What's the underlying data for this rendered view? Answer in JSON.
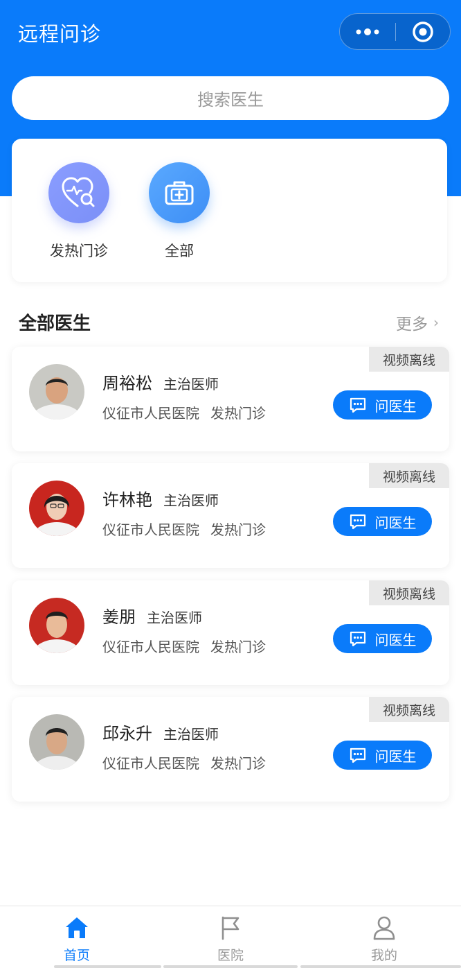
{
  "header": {
    "title": "远程问诊"
  },
  "search": {
    "placeholder": "搜索医生"
  },
  "categories": [
    {
      "label": "发热门诊",
      "icon": "heart-search-icon"
    },
    {
      "label": "全部",
      "icon": "medical-kit-icon"
    }
  ],
  "section": {
    "title": "全部医生",
    "more_label": "更多"
  },
  "doctors": [
    {
      "name": "周裕松",
      "title": "主治医师",
      "hospital": "仪征市人民医院",
      "dept": "发热门诊",
      "status": "视频离线",
      "action": "问医生"
    },
    {
      "name": "许林艳",
      "title": "主治医师",
      "hospital": "仪征市人民医院",
      "dept": "发热门诊",
      "status": "视频离线",
      "action": "问医生"
    },
    {
      "name": "姜朋",
      "title": "主治医师",
      "hospital": "仪征市人民医院",
      "dept": "发热门诊",
      "status": "视频离线",
      "action": "问医生"
    },
    {
      "name": "邱永升",
      "title": "主治医师",
      "hospital": "仪征市人民医院",
      "dept": "发热门诊",
      "status": "视频离线",
      "action": "问医生"
    }
  ],
  "tabbar": [
    {
      "label": "首页",
      "icon": "home-icon",
      "active": true
    },
    {
      "label": "医院",
      "icon": "flag-icon",
      "active": false
    },
    {
      "label": "我的",
      "icon": "user-icon",
      "active": false
    }
  ],
  "colors": {
    "primary": "#0a7bfa",
    "tag_bg": "#e9e9e9"
  }
}
